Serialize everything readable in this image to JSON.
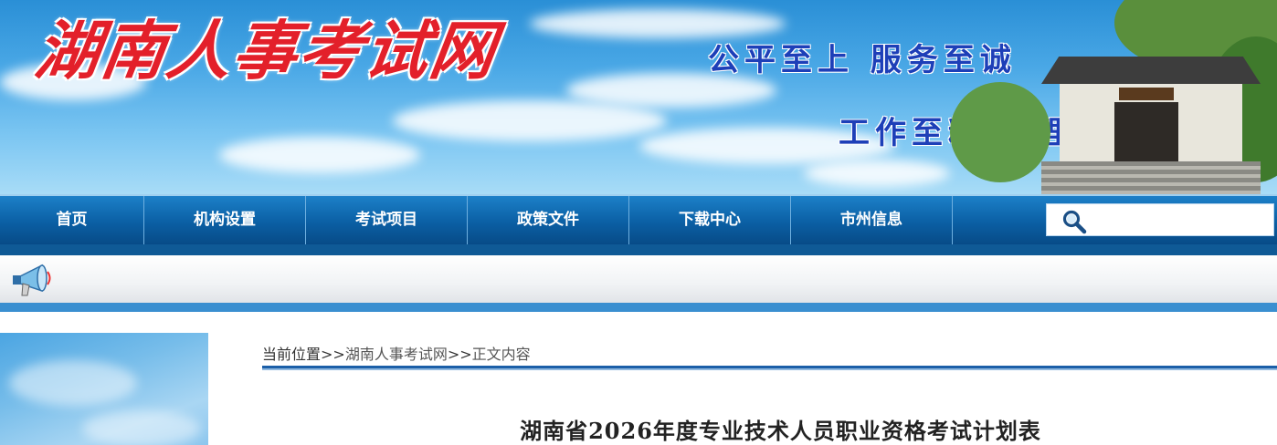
{
  "header": {
    "site_title": "湖南人事考试网",
    "slogan_line1": "公平至上 服务至诚",
    "slogan_line2": "工作至精 管理至严"
  },
  "nav": {
    "items": [
      {
        "label": "首页"
      },
      {
        "label": "机构设置"
      },
      {
        "label": "考试项目"
      },
      {
        "label": "政策文件"
      },
      {
        "label": "下载中心"
      },
      {
        "label": "市州信息"
      }
    ],
    "search_placeholder": ""
  },
  "breadcrumb": {
    "prefix": "当前位置",
    "sep": ">>",
    "home": "湖南人事考试网",
    "current": "正文内容"
  },
  "article": {
    "title": "湖南省2026年度专业技术人员职业资格考试计划表"
  },
  "colors": {
    "nav_bg": "#0b5fa4",
    "logo_red": "#e3202a",
    "slogan_blue": "#1d3fb8"
  }
}
